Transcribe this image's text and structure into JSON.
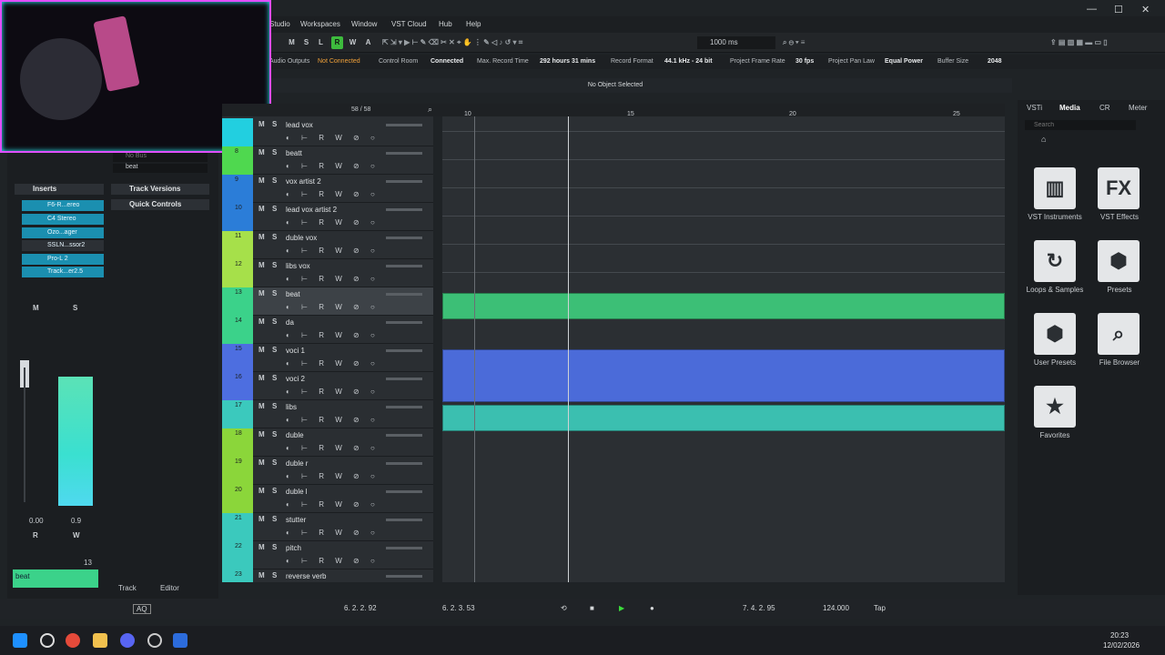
{
  "window": {
    "menu": [
      "Studio",
      "Workspaces",
      "Window",
      "VST Cloud",
      "Hub",
      "Help"
    ],
    "controls": [
      "—",
      "☐",
      "✕"
    ]
  },
  "toolbar": {
    "labels": [
      "M",
      "S",
      "L",
      "R",
      "W",
      "A"
    ],
    "time_display": "1000 ms"
  },
  "status": {
    "audio_outputs_label": "Audio Outputs",
    "audio_outputs_value": "Not Connected",
    "control_room_label": "Control Room",
    "control_room_value": "Connected",
    "max_record_label": "Max. Record Time",
    "max_record_value": "292 hours 31 mins",
    "record_format_label": "Record Format",
    "record_format_value": "44.1 kHz - 24 bit",
    "frame_rate_label": "Project Frame Rate",
    "frame_rate_value": "30 fps",
    "pan_law_label": "Project Pan Law",
    "pan_law_value": "Equal Power",
    "buffer_label": "Buffer Size",
    "buffer_value": "2048"
  },
  "info_line": "No Object Selected",
  "tracklist": {
    "count": "58 / 58"
  },
  "inspector": {
    "bus": "No Bus",
    "output": "beat",
    "inserts_label": "Inserts",
    "inserts": [
      "F6-R...ereo",
      "C4 Stereo",
      "Ozo...ager",
      "SSLN...ssor2",
      "Pro-L 2",
      "Track...er2.5"
    ],
    "track_versions": "Track Versions",
    "quick_controls": "Quick Controls",
    "fader_values": [
      "0.00",
      "0.9"
    ],
    "track_number": "13",
    "track_name": "beat",
    "tabs": [
      "Track",
      "Editor"
    ]
  },
  "tracks": [
    {
      "n": "",
      "name": "lead vox",
      "color": "#22cfe0"
    },
    {
      "n": "8",
      "name": "beatt",
      "color": "#4fd84f"
    },
    {
      "n": "9",
      "name": "vox artist 2",
      "color": "#2b7dd8"
    },
    {
      "n": "10",
      "name": "lead vox artist 2",
      "color": "#2b7dd8"
    },
    {
      "n": "11",
      "name": "duble vox",
      "color": "#a6e04a"
    },
    {
      "n": "12",
      "name": "libs vox",
      "color": "#a6e04a"
    },
    {
      "n": "13",
      "name": "beat",
      "color": "#3bd28a"
    },
    {
      "n": "14",
      "name": "da",
      "color": "#3bd28a"
    },
    {
      "n": "15",
      "name": "voci 1",
      "color": "#4d6ee0"
    },
    {
      "n": "16",
      "name": "voci 2",
      "color": "#4d6ee0"
    },
    {
      "n": "17",
      "name": "libs",
      "color": "#3bc9bd"
    },
    {
      "n": "18",
      "name": "duble",
      "color": "#8bd63a"
    },
    {
      "n": "19",
      "name": "duble r",
      "color": "#8bd63a"
    },
    {
      "n": "20",
      "name": "duble l",
      "color": "#8bd63a"
    },
    {
      "n": "21",
      "name": "stutter",
      "color": "#3bc9bd"
    },
    {
      "n": "22",
      "name": "pitch",
      "color": "#3bc9bd"
    },
    {
      "n": "23",
      "name": "reverse verb",
      "color": "#3bc9bd"
    }
  ],
  "ruler": [
    "10",
    "15",
    "20",
    "25"
  ],
  "media": {
    "tabs": [
      "VSTi",
      "Media",
      "CR",
      "Meter"
    ],
    "search_placeholder": "Search",
    "tiles": [
      "VST Instruments",
      "VST Effects",
      "Loops & Samples",
      "Presets",
      "User Presets",
      "File Browser",
      "Favorites"
    ]
  },
  "transport": {
    "left_locator": "6. 2. 2. 92",
    "right_locator": "6. 2. 3. 53",
    "position": "7. 4. 2. 95",
    "tempo": "124.000",
    "tap": "Tap",
    "aq": "AQ"
  },
  "clock": {
    "time": "20:23",
    "date": "12/02/2026"
  }
}
